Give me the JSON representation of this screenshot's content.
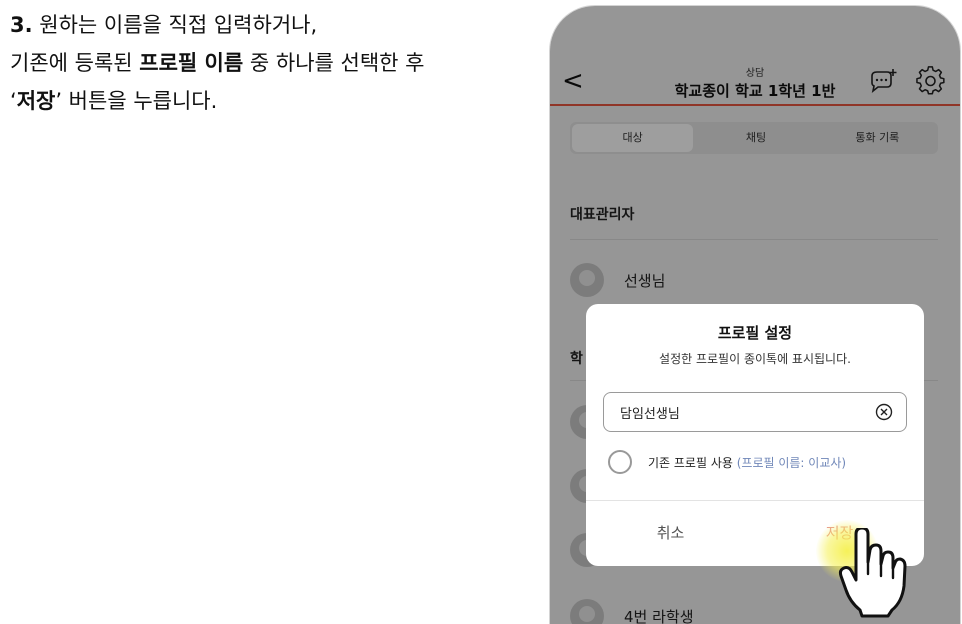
{
  "instructions": {
    "line1_num": "3.",
    "line1_text": " 원하는 이름을 직접 입력하거나,",
    "line2_pre": "기존에 등록된 ",
    "line2_bold": "프로필 이름",
    "line2_post": " 중 하나를 선택한 후",
    "line3_quote_open": "‘",
    "line3_bold": "저장",
    "line3_post": "’ 버튼을 누릅니다."
  },
  "header": {
    "back_glyph": "<",
    "subtitle": "상담",
    "title": "학교종이 학교 1학년 1반"
  },
  "tabs": [
    {
      "label": "대상",
      "active": true
    },
    {
      "label": "채팅",
      "active": false
    },
    {
      "label": "통화 기록",
      "active": false
    }
  ],
  "sections": {
    "admin_title": "대표관리자",
    "students_title": "학"
  },
  "members": [
    {
      "name": "선생님"
    },
    {
      "name": ""
    },
    {
      "name": ""
    },
    {
      "name": ""
    },
    {
      "name": "4번 라학생"
    }
  ],
  "dialog": {
    "title": "프로필 설정",
    "description": "설정한 프로필이 종이톡에 표시됩니다.",
    "input_value": "담임선생님",
    "radio_label": "기존 프로필 사용 ",
    "radio_hint": "(프로필 이름: 이교사)",
    "cancel_label": "취소",
    "save_label": "저장"
  },
  "colors": {
    "accent_line": "#e8563f",
    "save_text": "#e89a8f",
    "hint_text": "#7087b8",
    "highlight": "#f5f050"
  },
  "icons": {
    "back": "chevron-left-icon",
    "chat_add": "chat-add-icon",
    "settings": "gear-icon",
    "clear": "clear-circle-icon",
    "pointer": "hand-pointer-icon"
  }
}
